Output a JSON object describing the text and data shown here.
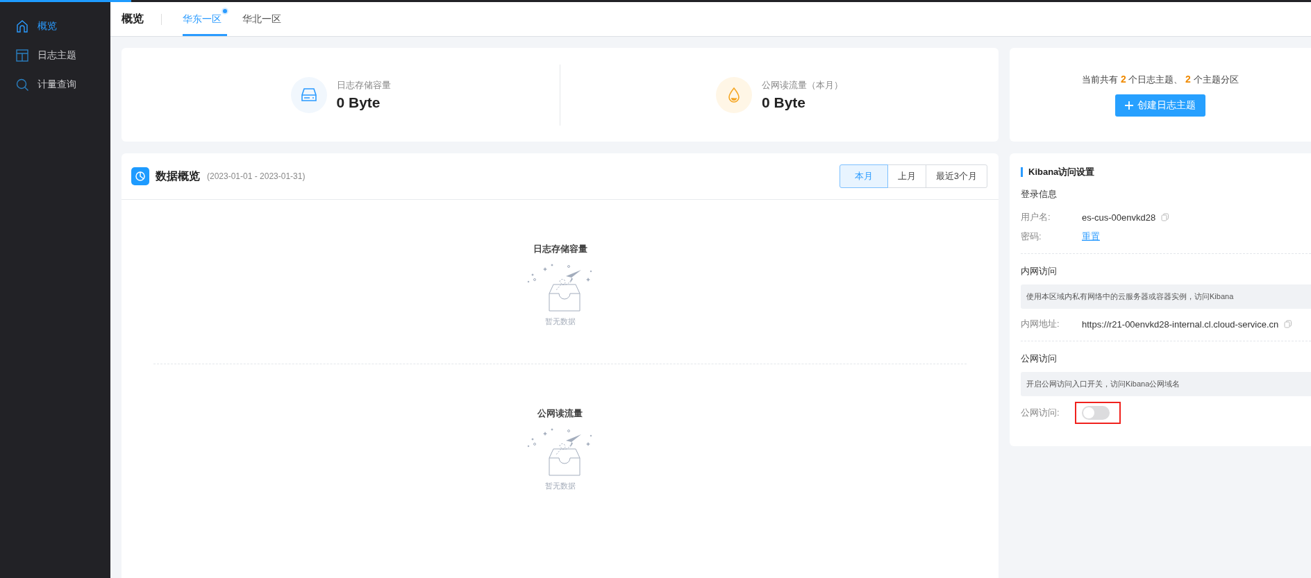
{
  "loading_bar": {
    "level": 0.1
  },
  "sidebar": {
    "items": [
      {
        "label": "概览",
        "selected": true
      },
      {
        "label": "日志主题",
        "selected": false
      },
      {
        "label": "计量查询",
        "selected": false
      }
    ]
  },
  "header": {
    "title": "概览",
    "tabs": [
      {
        "label": "华东一区",
        "selected": true,
        "badge": true
      },
      {
        "label": "华北一区",
        "selected": false,
        "badge": false
      }
    ]
  },
  "stats": [
    {
      "kind": "storage",
      "label": "日志存储容量",
      "value": "0 Byte"
    },
    {
      "kind": "traffic",
      "label": "公网读流量（本月）",
      "value": "0 Byte"
    }
  ],
  "data_overview": {
    "title": "数据概览",
    "date_range": "(2023-01-01 - 2023-01-31)",
    "periods": [
      {
        "label": "本月",
        "selected": true
      },
      {
        "label": "上月",
        "selected": false
      },
      {
        "label": "最近3个月",
        "selected": false
      }
    ],
    "charts": [
      {
        "title": "日志存储容量",
        "empty_text": "暂无数据"
      },
      {
        "title": "公网读流量",
        "empty_text": "暂无数据"
      }
    ]
  },
  "topic_summary": {
    "text": "当前共有 **2** 个日志主题、 **2** 个主题分区",
    "button": "创建日志主题"
  },
  "kibana": {
    "title": "Kibana访问设置",
    "sections": [
      {
        "heading": "登录信息",
        "fields": [
          {
            "label": "用户名:",
            "value": "es-cus-00envkd28",
            "kind": "copy"
          },
          {
            "label": "密码:",
            "value": "重置",
            "kind": "link"
          }
        ]
      },
      {
        "heading": "内网访问",
        "note": "使用本区域内私有网络中的云服务器或容器实例，访问Kibana",
        "fields": [
          {
            "label": "内网地址:",
            "value": "https://r21-00envkd28-internal.cl.cloud-service.cn",
            "kind": "copy"
          }
        ]
      },
      {
        "heading": "公网访问",
        "note": "开启公网访问入口开关，访问Kibana公网域名",
        "fields": [
          {
            "label": "公网访问:",
            "kind": "switch",
            "on": false,
            "highlighted": true
          }
        ]
      }
    ]
  }
}
